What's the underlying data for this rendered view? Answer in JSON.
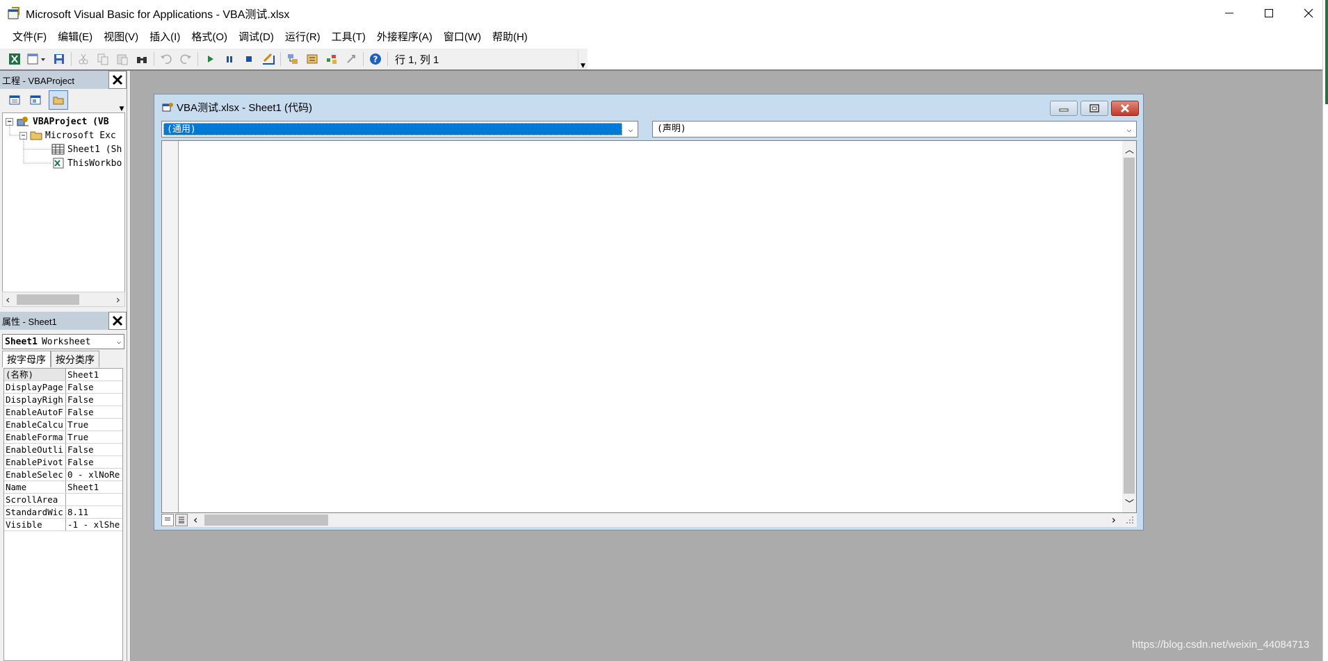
{
  "window": {
    "title": "Microsoft Visual Basic for Applications - VBA测试.xlsx",
    "controls": {
      "minimize": "—",
      "maximize": "☐",
      "close": "✕"
    }
  },
  "menu": {
    "items": [
      "文件(F)",
      "编辑(E)",
      "视图(V)",
      "插入(I)",
      "格式(O)",
      "调试(D)",
      "运行(R)",
      "工具(T)",
      "外接程序(A)",
      "窗口(W)",
      "帮助(H)"
    ]
  },
  "toolbar": {
    "position": "行 1, 列 1",
    "icons": [
      "excel-icon",
      "insert-form-icon",
      "save-icon",
      "cut-icon",
      "copy-icon",
      "paste-icon",
      "find-icon",
      "undo-icon",
      "redo-icon",
      "run-icon",
      "break-icon",
      "reset-icon",
      "design-mode-icon",
      "project-explorer-icon",
      "properties-icon",
      "object-browser-icon",
      "toolbox-icon",
      "help-icon"
    ]
  },
  "project_pane": {
    "title": "工程 - VBAProject",
    "close": "✕",
    "tree": [
      {
        "label": "VBAProject (VB",
        "bold": true
      },
      {
        "label": "Microsoft Exc",
        "bold": false
      },
      {
        "label": "Sheet1 (Sh",
        "bold": false
      },
      {
        "label": "ThisWorkbo",
        "bold": false
      }
    ]
  },
  "properties_pane": {
    "title": "属性 - Sheet1",
    "close": "✕",
    "object_name": "Sheet1",
    "object_type": "Worksheet",
    "tabs": [
      "按字母序",
      "按分类序"
    ],
    "rows": [
      {
        "name": "(名称)",
        "value": "Sheet1"
      },
      {
        "name": "DisplayPage",
        "value": "False"
      },
      {
        "name": "DisplayRigh",
        "value": "False"
      },
      {
        "name": "EnableAutoF",
        "value": "False"
      },
      {
        "name": "EnableCalcu",
        "value": "True"
      },
      {
        "name": "EnableForma",
        "value": "True"
      },
      {
        "name": "EnableOutli",
        "value": "False"
      },
      {
        "name": "EnablePivot",
        "value": "False"
      },
      {
        "name": "EnableSelec",
        "value": "0 - xlNoRe"
      },
      {
        "name": "Name",
        "value": "Sheet1"
      },
      {
        "name": "ScrollArea",
        "value": ""
      },
      {
        "name": "StandardWic",
        "value": "8.11"
      },
      {
        "name": "Visible",
        "value": "-1 - xlShe"
      }
    ]
  },
  "code_window": {
    "title": "VBA测试.xlsx - Sheet1 (代码)",
    "object_combo": "(通用)",
    "procedure_combo": "(声明)"
  },
  "watermark": "https://blog.csdn.net/weixin_44084713"
}
